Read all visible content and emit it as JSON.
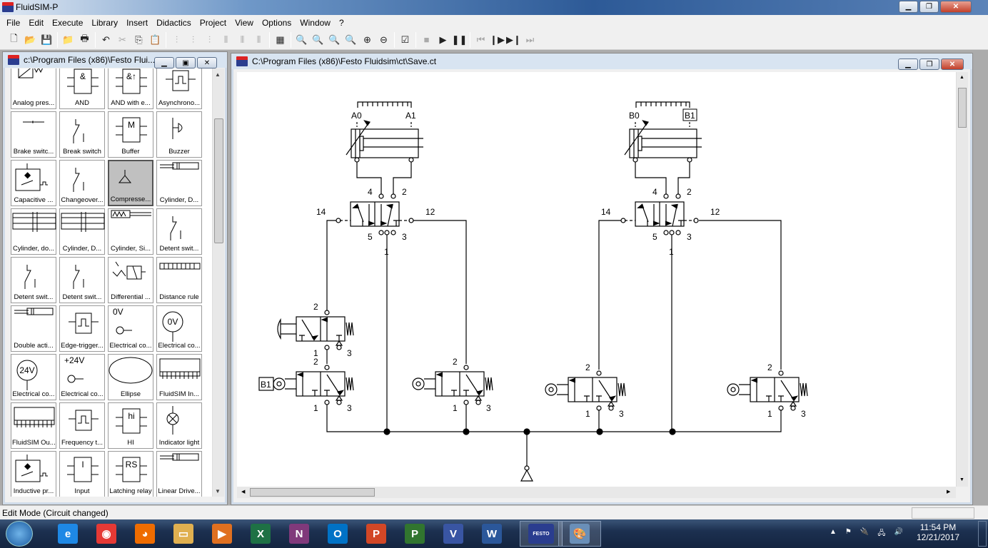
{
  "app": {
    "title": "FluidSIM-P",
    "logo_text": "FESTO"
  },
  "menu": [
    "File",
    "Edit",
    "Execute",
    "Library",
    "Insert",
    "Didactics",
    "Project",
    "View",
    "Options",
    "Window",
    "?"
  ],
  "toolbar": [
    {
      "icon": "new-icon",
      "g": "🗋"
    },
    {
      "icon": "open-icon",
      "g": "📂"
    },
    {
      "icon": "save-icon",
      "g": "💾"
    },
    {
      "sep": true
    },
    {
      "icon": "open-project-icon",
      "g": "📁"
    },
    {
      "icon": "print-icon",
      "g": "🖶"
    },
    {
      "sep": true
    },
    {
      "icon": "undo-icon",
      "g": "↶"
    },
    {
      "icon": "cut-icon",
      "g": "✂",
      "dis": true
    },
    {
      "icon": "copy-icon",
      "g": "⎘"
    },
    {
      "icon": "paste-icon",
      "g": "📋"
    },
    {
      "sep": true
    },
    {
      "icon": "align-left-icon",
      "g": "⫶",
      "dis": true
    },
    {
      "icon": "align-center-icon",
      "g": "⫶",
      "dis": true
    },
    {
      "icon": "align-right-icon",
      "g": "⫶",
      "dis": true
    },
    {
      "icon": "align-top-icon",
      "g": "⫴",
      "dis": true
    },
    {
      "icon": "align-middle-icon",
      "g": "⫴",
      "dis": true
    },
    {
      "icon": "align-bottom-icon",
      "g": "⫴",
      "dis": true
    },
    {
      "sep": true
    },
    {
      "icon": "grid-icon",
      "g": "▦"
    },
    {
      "sep": true
    },
    {
      "icon": "zoom-1-1-icon",
      "g": "🔍"
    },
    {
      "icon": "zoom-fit-width-icon",
      "g": "🔍"
    },
    {
      "icon": "zoom-fit-icon",
      "g": "🔍"
    },
    {
      "icon": "zoom-window-icon",
      "g": "🔍"
    },
    {
      "icon": "zoom-in-icon",
      "g": "⊕"
    },
    {
      "icon": "zoom-out-icon",
      "g": "⊖"
    },
    {
      "sep": true
    },
    {
      "icon": "check-circuit-icon",
      "g": "☑"
    },
    {
      "sep": true
    },
    {
      "icon": "stop-icon",
      "g": "■",
      "dis": true
    },
    {
      "icon": "play-icon",
      "g": "▶"
    },
    {
      "icon": "pause-icon",
      "g": "❚❚"
    },
    {
      "sep": true
    },
    {
      "icon": "reset-icon",
      "g": "⏮",
      "dis": true
    },
    {
      "icon": "step-icon",
      "g": "❙▶"
    },
    {
      "icon": "step-to-end-icon",
      "g": "▶❙"
    },
    {
      "icon": "fast-forward-icon",
      "g": "⏭",
      "dis": true
    }
  ],
  "library": {
    "title": "c:\\Program Files (x86)\\Festo Flui...",
    "items": [
      {
        "label": "Analog pres...",
        "sym": "analog"
      },
      {
        "label": "AND",
        "sym": "box",
        "txt": "&"
      },
      {
        "label": "AND with e...",
        "sym": "box",
        "txt": "&↑"
      },
      {
        "label": "Asynchrono...",
        "sym": "pulse"
      },
      {
        "label": "Brake switc...",
        "sym": "brake"
      },
      {
        "label": "Break switch",
        "sym": "switch"
      },
      {
        "label": "Buffer",
        "sym": "box",
        "txt": "M"
      },
      {
        "label": "Buzzer",
        "sym": "buzzer"
      },
      {
        "label": "Capacitive ...",
        "sym": "sensor"
      },
      {
        "label": "Changeover...",
        "sym": "switch"
      },
      {
        "label": "Compresse...",
        "sym": "triangle",
        "selected": true
      },
      {
        "label": "Cylinder, D...",
        "sym": "cylsmall"
      },
      {
        "label": "Cylinder, do...",
        "sym": "cyl"
      },
      {
        "label": "Cylinder, D...",
        "sym": "cyl"
      },
      {
        "label": "Cylinder, Si...",
        "sym": "cylspring"
      },
      {
        "label": "Detent swit...",
        "sym": "switch"
      },
      {
        "label": "Detent swit...",
        "sym": "switch"
      },
      {
        "label": "Detent swit...",
        "sym": "switch"
      },
      {
        "label": "Differential ...",
        "sym": "diff"
      },
      {
        "label": "Distance rule",
        "sym": "rule"
      },
      {
        "label": "Double acti...",
        "sym": "cylsmall"
      },
      {
        "label": "Edge-trigger...",
        "sym": "pulse"
      },
      {
        "label": "Electrical co...",
        "sym": "conn",
        "txt": "0V"
      },
      {
        "label": "Electrical co...",
        "sym": "circle",
        "txt": "0V"
      },
      {
        "label": "Electrical co...",
        "sym": "circle",
        "txt": "24V"
      },
      {
        "label": "Electrical co...",
        "sym": "conn",
        "txt": "+24V"
      },
      {
        "label": "Ellipse",
        "sym": "ellipse"
      },
      {
        "label": "FluidSIM In...",
        "sym": "io"
      },
      {
        "label": "FluidSIM Ou...",
        "sym": "io"
      },
      {
        "label": "Frequency t...",
        "sym": "pulse"
      },
      {
        "label": "HI",
        "sym": "box",
        "txt": "hi"
      },
      {
        "label": "Indicator light",
        "sym": "lamp"
      },
      {
        "label": "Inductive pr...",
        "sym": "sensor"
      },
      {
        "label": "Input",
        "sym": "box",
        "txt": "I"
      },
      {
        "label": "Latching relay",
        "sym": "box",
        "txt": "RS"
      },
      {
        "label": "Linear Drive...",
        "sym": "cylsmall"
      }
    ]
  },
  "circuit_window": {
    "title": "C:\\Program Files (x86)\\Festo Fluidsim\\ct\\Save.ct"
  },
  "circuit": {
    "cylA": {
      "left": "A0",
      "right": "A1"
    },
    "cylB": {
      "left": "B0",
      "right": "B1"
    },
    "valveA": {
      "p4": "4",
      "p2": "2",
      "p14": "14",
      "p12": "12",
      "p5": "5",
      "p3": "3",
      "p1": "1"
    },
    "valveB": {
      "p4": "4",
      "p2": "2",
      "p14": "14",
      "p12": "12",
      "p5": "5",
      "p3": "3",
      "p1": "1"
    },
    "pushbutton_valve": {
      "p2": "2",
      "p1": "1",
      "p3": "3"
    },
    "roller_b1": {
      "tag": "B1",
      "p2": "2",
      "p1": "1",
      "p3": "3"
    },
    "roller_a1": {
      "p2": "2",
      "p1": "1",
      "p3": "3"
    },
    "roller_b0": {
      "p2": "2",
      "p1": "1",
      "p3": "3"
    },
    "roller_b1r": {
      "p2": "2",
      "p1": "1",
      "p3": "3"
    }
  },
  "status": {
    "text": "Edit Mode (Circuit changed)"
  },
  "taskbar": {
    "apps": [
      {
        "name": "internet-explorer",
        "g": "e",
        "c": "#1e88e5"
      },
      {
        "name": "chrome",
        "g": "◉",
        "c": "#e53935"
      },
      {
        "name": "firefox",
        "g": "◕",
        "c": "#ef6c00"
      },
      {
        "name": "file-explorer",
        "g": "▭",
        "c": "#e0b050"
      },
      {
        "name": "media-player",
        "g": "▶",
        "c": "#e07020"
      },
      {
        "name": "excel",
        "g": "X",
        "c": "#1e7145"
      },
      {
        "name": "onenote",
        "g": "N",
        "c": "#80397b"
      },
      {
        "name": "outlook",
        "g": "O",
        "c": "#0072c6"
      },
      {
        "name": "powerpoint",
        "g": "P",
        "c": "#d24726"
      },
      {
        "name": "project",
        "g": "P",
        "c": "#31752f"
      },
      {
        "name": "visio",
        "g": "V",
        "c": "#3955a3"
      },
      {
        "name": "word",
        "g": "W",
        "c": "#2b579a"
      },
      {
        "name": "fluidsim",
        "g": "FESTO",
        "c": "#2a3d8f"
      },
      {
        "name": "paint",
        "g": "🎨",
        "c": "#6a8fb8"
      }
    ],
    "clock_time": "11:54 PM",
    "clock_date": "12/21/2017"
  }
}
